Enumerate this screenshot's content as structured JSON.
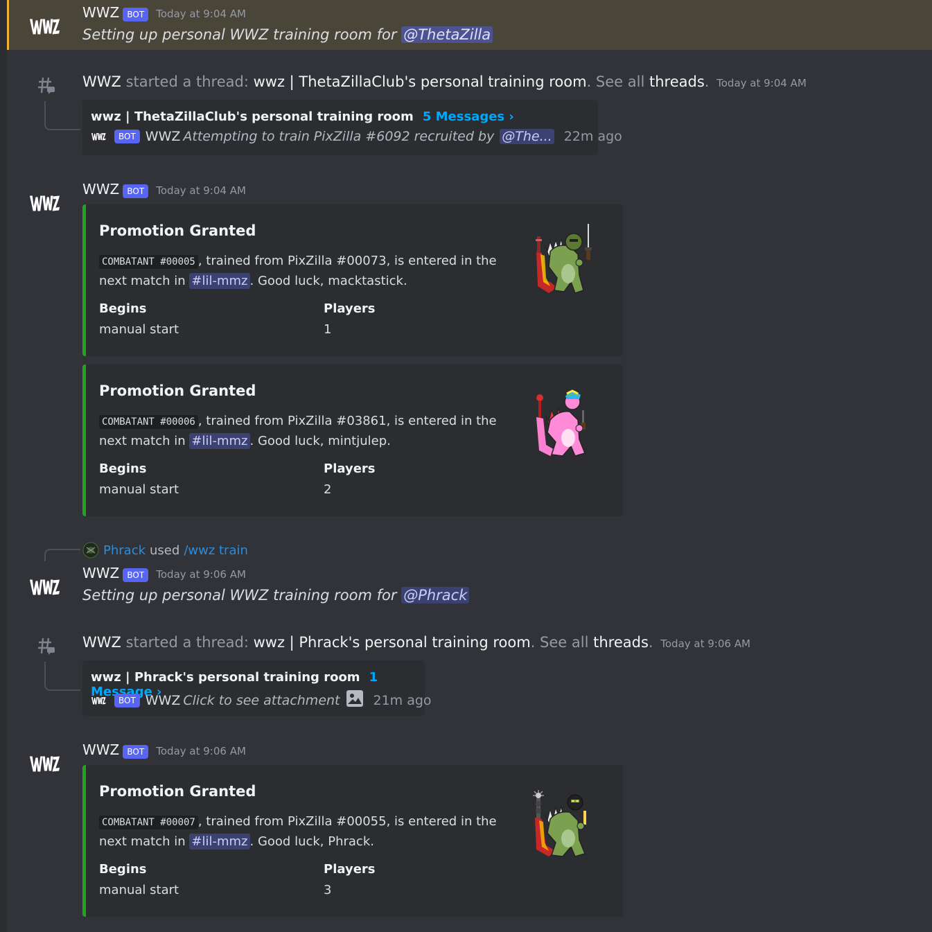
{
  "messages": {
    "m1": {
      "author": "WWZ",
      "bot_tag": "BOT",
      "timestamp": "Today at 9:04 AM",
      "text": "Setting up personal WWZ training room for",
      "mention": "@ThetaZilla"
    },
    "t1": {
      "author": "WWZ",
      "started": "started a thread:",
      "thread_name": "wwz | ThetaZillaClub's personal training room",
      "see_all": ". See all",
      "threads_link": "threads",
      "period": ".",
      "timestamp": "Today at 9:04 AM",
      "card_title": "wwz | ThetaZillaClub's personal training room",
      "card_count": "5 Messages ›",
      "preview_bot": "BOT",
      "preview_author": "WWZ",
      "preview_text": "Attempting to train PixZilla #6092 recruited by",
      "preview_mention": "@The...",
      "preview_ago": "22m ago"
    },
    "m2": {
      "author": "WWZ",
      "bot_tag": "BOT",
      "timestamp": "Today at 9:04 AM",
      "embeds": [
        {
          "title": "Promotion Granted",
          "code": "COMBATANT #00005",
          "desc_a": ", trained from PixZilla #00073, is entered in the",
          "desc_b": "next match in",
          "channel": "#lil-mmz",
          "desc_c": ". Good luck, macktastick.",
          "f1_name": "Begins",
          "f1_value": "manual start",
          "f2_name": "Players",
          "f2_value": "1"
        },
        {
          "title": "Promotion Granted",
          "code": "COMBATANT #00006",
          "desc_a": ", trained from PixZilla #03861, is entered in the",
          "desc_b": "next match in",
          "channel": "#lil-mmz",
          "desc_c": ". Good luck, mintjulep.",
          "f1_name": "Begins",
          "f1_value": "manual start",
          "f2_name": "Players",
          "f2_value": "2"
        }
      ]
    },
    "m3": {
      "reply_user": "Phrack",
      "reply_used": "used",
      "reply_command": "/wwz train",
      "author": "WWZ",
      "bot_tag": "BOT",
      "timestamp": "Today at 9:06 AM",
      "text": "Setting up personal WWZ training room for",
      "mention": "@Phrack"
    },
    "t2": {
      "author": "WWZ",
      "started": "started a thread:",
      "thread_name": "wwz | Phrack's personal training room",
      "see_all": ". See all",
      "threads_link": "threads",
      "period": ".",
      "timestamp": "Today at 9:06 AM",
      "card_title": "wwz | Phrack's personal training room",
      "card_count": "1 Message ›",
      "preview_bot": "BOT",
      "preview_author": "WWZ",
      "preview_text": "Click to see attachment",
      "preview_ago": "21m ago"
    },
    "m4": {
      "author": "WWZ",
      "bot_tag": "BOT",
      "timestamp": "Today at 9:06 AM",
      "embeds": [
        {
          "title": "Promotion Granted",
          "code": "COMBATANT #00007",
          "desc_a": ", trained from PixZilla #00055, is entered in the",
          "desc_b": "next match in",
          "channel": "#lil-mmz",
          "desc_c": ". Good luck, Phrack.",
          "f1_name": "Begins",
          "f1_value": "manual start",
          "f2_name": "Players",
          "f2_value": "3"
        }
      ]
    }
  },
  "colors": {
    "background": "#313338",
    "highlight": "#4a4539",
    "highlight_bar": "#f0b232",
    "bot_badge": "#5865f2",
    "embed_bar": "#1fa41f",
    "link": "#00a8fc"
  },
  "avatar_text": "WWZ"
}
